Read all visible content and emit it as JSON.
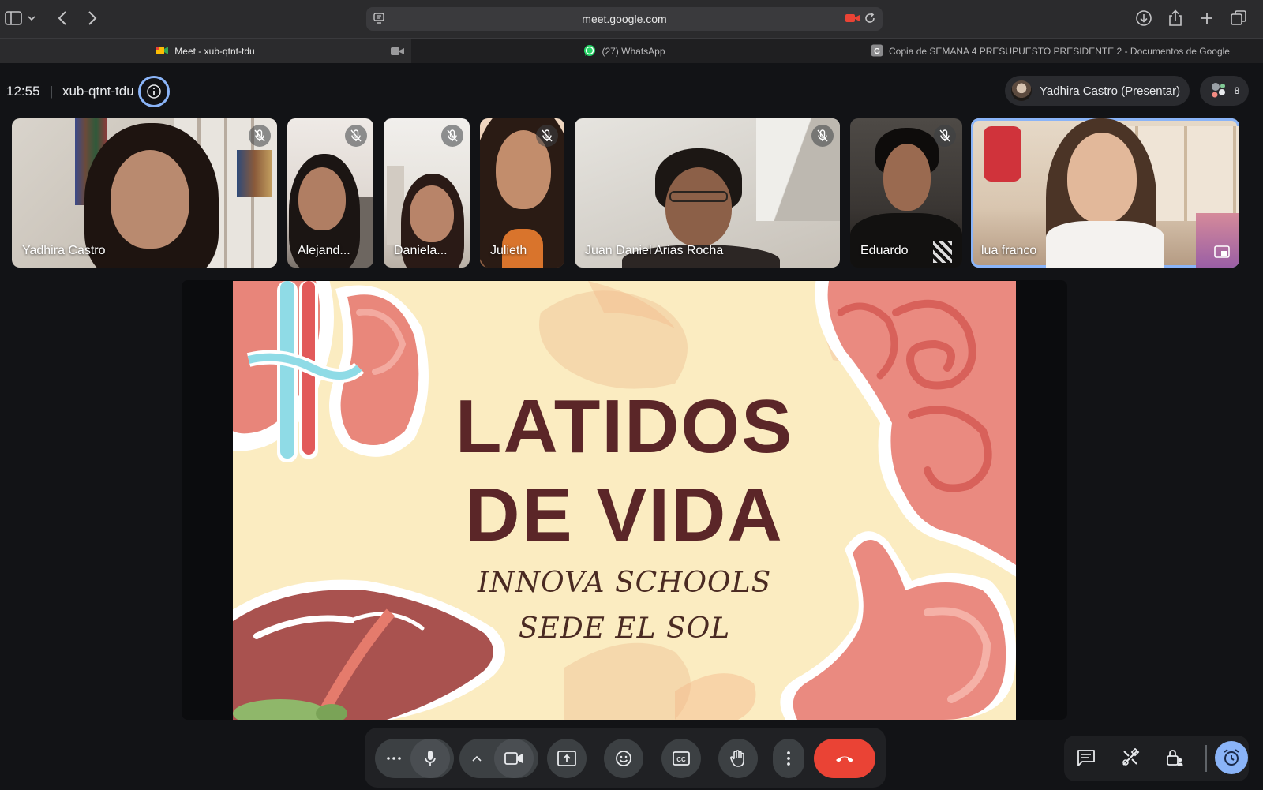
{
  "browser": {
    "url": "meet.google.com",
    "tabs": [
      {
        "title": "Meet - xub-qtnt-tdu",
        "active": true
      },
      {
        "title": "(27) WhatsApp",
        "active": false
      },
      {
        "title": "Copia de SEMANA 4 PRESUPUESTO PRESIDENTE 2 - Documentos de Google",
        "active": false
      }
    ]
  },
  "meeting": {
    "time": "12:55",
    "code": "xub-qtnt-tdu",
    "presenter_label": "Yadhira Castro (Presentar)",
    "participants_count": "8"
  },
  "participants": [
    {
      "name": "Yadhira Castro",
      "muted": true
    },
    {
      "name": "Alejand...",
      "muted": true
    },
    {
      "name": "Daniela...",
      "muted": true
    },
    {
      "name": "Julieth",
      "muted": true
    },
    {
      "name": "Juan Daniel Arias Rocha",
      "muted": true
    },
    {
      "name": "Eduardo",
      "muted": true
    },
    {
      "name": "lua franco",
      "muted": false,
      "active": true
    }
  ],
  "slide": {
    "title_line1": "LATIDOS",
    "title_line2": "DE VIDA",
    "subtitle_line1": "INNOVA SCHOOLS",
    "subtitle_line2": "SEDE EL SOL"
  },
  "colors": {
    "accent": "#8ab4f8",
    "end_call": "#ea4335",
    "slide_bg": "#fbecc1",
    "slide_title": "#5b2628"
  }
}
